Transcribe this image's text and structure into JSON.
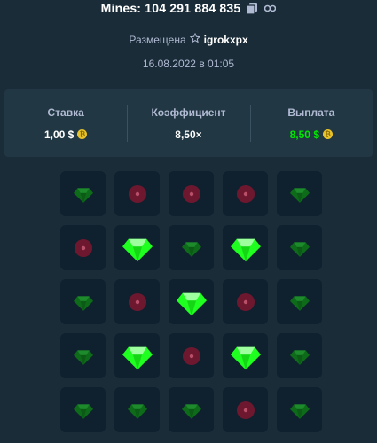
{
  "header": {
    "title": "Mines: 104 291 884 835",
    "copy_icon": "copy-icon",
    "link_icon": "link-icon"
  },
  "placement": {
    "label": "Размещена",
    "star_icon": "star-icon",
    "user": "igrokxpx"
  },
  "date": "16.08.2022 в 01:05",
  "stats": [
    {
      "label": "Ставка",
      "value": "1,00 $",
      "currency_icon": "coin-icon",
      "accent": false
    },
    {
      "label": "Коэффициент",
      "value": "8,50×",
      "accent": false
    },
    {
      "label": "Выплата",
      "value": "8,50 $",
      "currency_icon": "coin-icon",
      "accent": true
    }
  ],
  "grid": {
    "rows": [
      [
        "gem",
        "mine",
        "mine",
        "mine",
        "gem"
      ],
      [
        "mine",
        "gem-revealed",
        "gem",
        "gem-revealed",
        "gem"
      ],
      [
        "gem",
        "mine",
        "gem-revealed",
        "mine",
        "gem"
      ],
      [
        "gem",
        "gem-revealed",
        "mine",
        "gem-revealed",
        "gem"
      ],
      [
        "gem",
        "gem",
        "gem",
        "mine",
        "gem"
      ]
    ]
  },
  "colors": {
    "background": "#1a2c38",
    "panel": "#213743",
    "tile": "#0f212e",
    "payout_green": "#00e701",
    "gem_bright": "#1fff20",
    "gem_dim": "#0e6b1a",
    "mine_dim": "#6e1830"
  }
}
